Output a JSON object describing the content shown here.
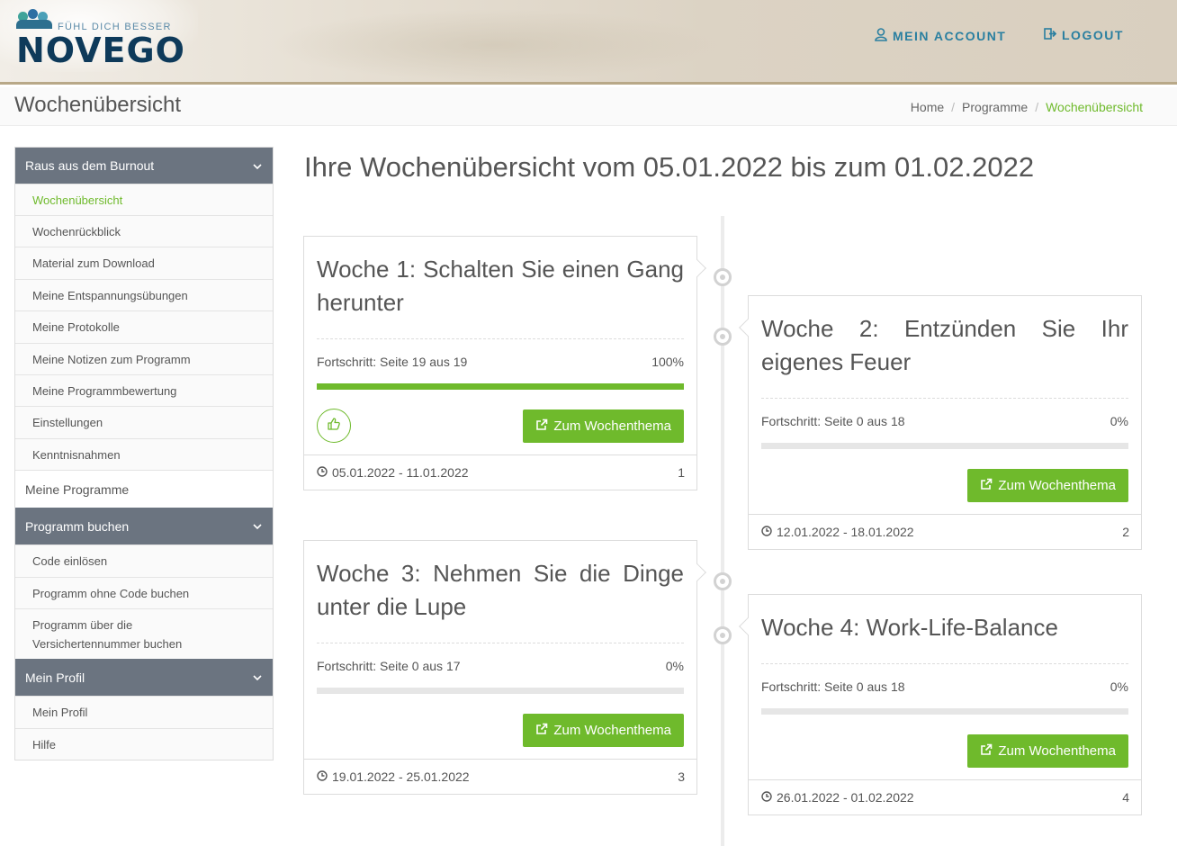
{
  "brand": {
    "slogan": "FÜHL DICH BESSER",
    "name": "NOVEGO"
  },
  "topnav": {
    "account": "MEIN ACCOUNT",
    "logout": "LOGOUT"
  },
  "page": {
    "title": "Wochenübersicht"
  },
  "breadcrumb": [
    "Home",
    "Programme",
    "Wochenübersicht"
  ],
  "sidebar": {
    "sections": [
      {
        "label": "Raus aus dem Burnout",
        "items": [
          "Wochenübersicht",
          "Wochenrückblick",
          "Material zum Download",
          "Meine Entspannungsübungen",
          "Meine Protokolle",
          "Meine Notizen zum Programm",
          "Meine Programmbewertung",
          "Einstellungen",
          "Kenntnisnahmen"
        ]
      },
      {
        "plain": "Meine Programme"
      },
      {
        "label": "Programm buchen",
        "items": [
          "Code einlösen",
          "Programm ohne Code buchen",
          "Programm über die Versichertennummer buchen"
        ]
      },
      {
        "label": "Mein Profil",
        "items": [
          "Mein Profil",
          "Hilfe"
        ]
      }
    ]
  },
  "main": {
    "heading": "Ihre Wochenübersicht vom 05.01.2022 bis zum 01.02.2022"
  },
  "weeks": [
    {
      "title": "Woche 1: Schalten Sie einen Gang herunter",
      "progress_label": "Fortschritt: Seite 19 aus 19",
      "progress_percent": "100%",
      "progress": 1.0,
      "button": "Zum Wochenthema",
      "dates": "05.01.2022 - 11.01.2022",
      "number": "1"
    },
    {
      "title": "Woche 2: Entzünden Sie Ihr eigenes Feuer",
      "progress_label": "Fortschritt: Seite 0 aus 18",
      "progress_percent": "0%",
      "progress": 0,
      "button": "Zum Wochenthema",
      "dates": "12.01.2022 - 18.01.2022",
      "number": "2"
    },
    {
      "title": "Woche 3: Nehmen Sie die Dinge unter die Lupe",
      "progress_label": "Fortschritt: Seite 0 aus 17",
      "progress_percent": "0%",
      "progress": 0,
      "button": "Zum Wochenthema",
      "dates": "19.01.2022 - 25.01.2022",
      "number": "3"
    },
    {
      "title": "Woche 4: Work-Life-Balance",
      "progress_label": "Fortschritt: Seite 0 aus 18",
      "progress_percent": "0%",
      "progress": 0,
      "button": "Zum Wochenthema",
      "dates": "26.01.2022 - 01.02.2022",
      "number": "4"
    }
  ],
  "colors": {
    "accent": "#6fba2c",
    "sidebar_header": "#6b7480",
    "brand": "#0e3a5a",
    "nav": "#2a7fa0"
  },
  "icons": {
    "account": "user-icon",
    "logout": "sign-out-icon",
    "chevron": "chevron-down-icon",
    "like": "thumbs-up-icon",
    "external": "external-link-icon",
    "clock": "clock-icon"
  }
}
